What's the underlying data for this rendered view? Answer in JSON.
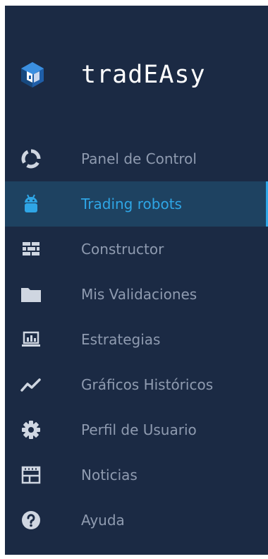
{
  "brand": {
    "name": "tradEAsy",
    "logo_icon": "cube-logo-icon"
  },
  "colors": {
    "sidebar_bg": "#1b2a44",
    "active_bg": "#1e4261",
    "accent": "#2fa6e6",
    "text": "#8f9bb0",
    "icon": "#cfd6e1"
  },
  "nav": {
    "items": [
      {
        "label": "Panel de Control",
        "icon": "dashboard-ring-icon",
        "active": false
      },
      {
        "label": "Trading robots",
        "icon": "android-robot-icon",
        "active": true
      },
      {
        "label": "Constructor",
        "icon": "bricks-icon",
        "active": false
      },
      {
        "label": "Mis Validaciones",
        "icon": "folder-icon",
        "active": false
      },
      {
        "label": "Estrategias",
        "icon": "laptop-chart-icon",
        "active": false
      },
      {
        "label": "Gráficos Históricos",
        "icon": "line-chart-icon",
        "active": false
      },
      {
        "label": "Perfil de Usuario",
        "icon": "gear-icon",
        "active": false
      },
      {
        "label": "Noticias",
        "icon": "newspaper-icon",
        "active": false
      },
      {
        "label": "Ayuda",
        "icon": "help-circle-icon",
        "active": false
      }
    ]
  }
}
